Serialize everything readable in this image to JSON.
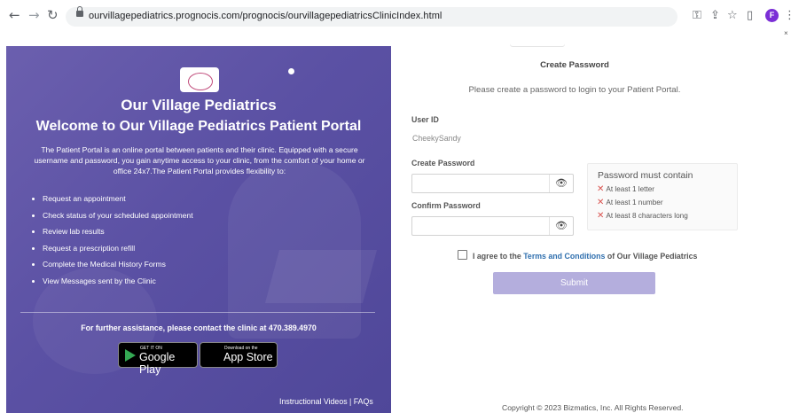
{
  "browser": {
    "url": "ourvillagepediatrics.prognocis.com/prognocis/ourvillagepediatricsClinicIndex.html",
    "profile_initial": "F"
  },
  "left": {
    "clinic_name": "Our Village Pediatrics",
    "welcome": "Welcome to Our Village Pediatrics Patient Portal",
    "intro": "The Patient Portal is an online portal between patients and their clinic. Equipped with a secure username and password, you gain anytime access to your clinic, from the comfort of your home or office 24x7.The Patient Portal provides flexibility to:",
    "features": [
      "Request an appointment",
      "Check status of your scheduled appointment",
      "Review lab results",
      "Request a prescription refill",
      "Complete the Medical History Forms",
      "View Messages sent by the Clinic"
    ],
    "assistance": "For further assistance, please contact the clinic at 470.389.4970",
    "google_play": {
      "small": "GET IT ON",
      "big": "Google Play"
    },
    "app_store": {
      "small": "Download on the",
      "big": "App Store"
    },
    "footer_links": "Instructional Videos | FAQs"
  },
  "form": {
    "title": "Create Password",
    "subtitle": "Please create a password to login to your Patient Portal.",
    "user_id_label": "User ID",
    "user_id_value": "CheekySandy",
    "create_label": "Create Password",
    "confirm_label": "Confirm Password",
    "create_value": "",
    "confirm_value": "",
    "rules_title": "Password must contain",
    "rules": [
      "At least 1 letter",
      "At least 1 number",
      "At least 8 characters long"
    ],
    "agree_prefix": "I agree to the ",
    "agree_link": "Terms and Conditions",
    "agree_suffix": " of Our Village Pediatrics",
    "submit_label": "Submit",
    "copyright": "Copyright © 2023 Bizmatics, Inc. All Rights Reserved."
  },
  "colors": {
    "panel": "#5b51a4",
    "submit": "#b4aedd",
    "link": "#2f6fae",
    "error": "#d9534f"
  },
  "icons": {
    "back": "arrow-left-icon",
    "forward": "arrow-right-icon",
    "reload": "reload-icon",
    "eye": "eye-icon",
    "cross": "cross-icon"
  }
}
